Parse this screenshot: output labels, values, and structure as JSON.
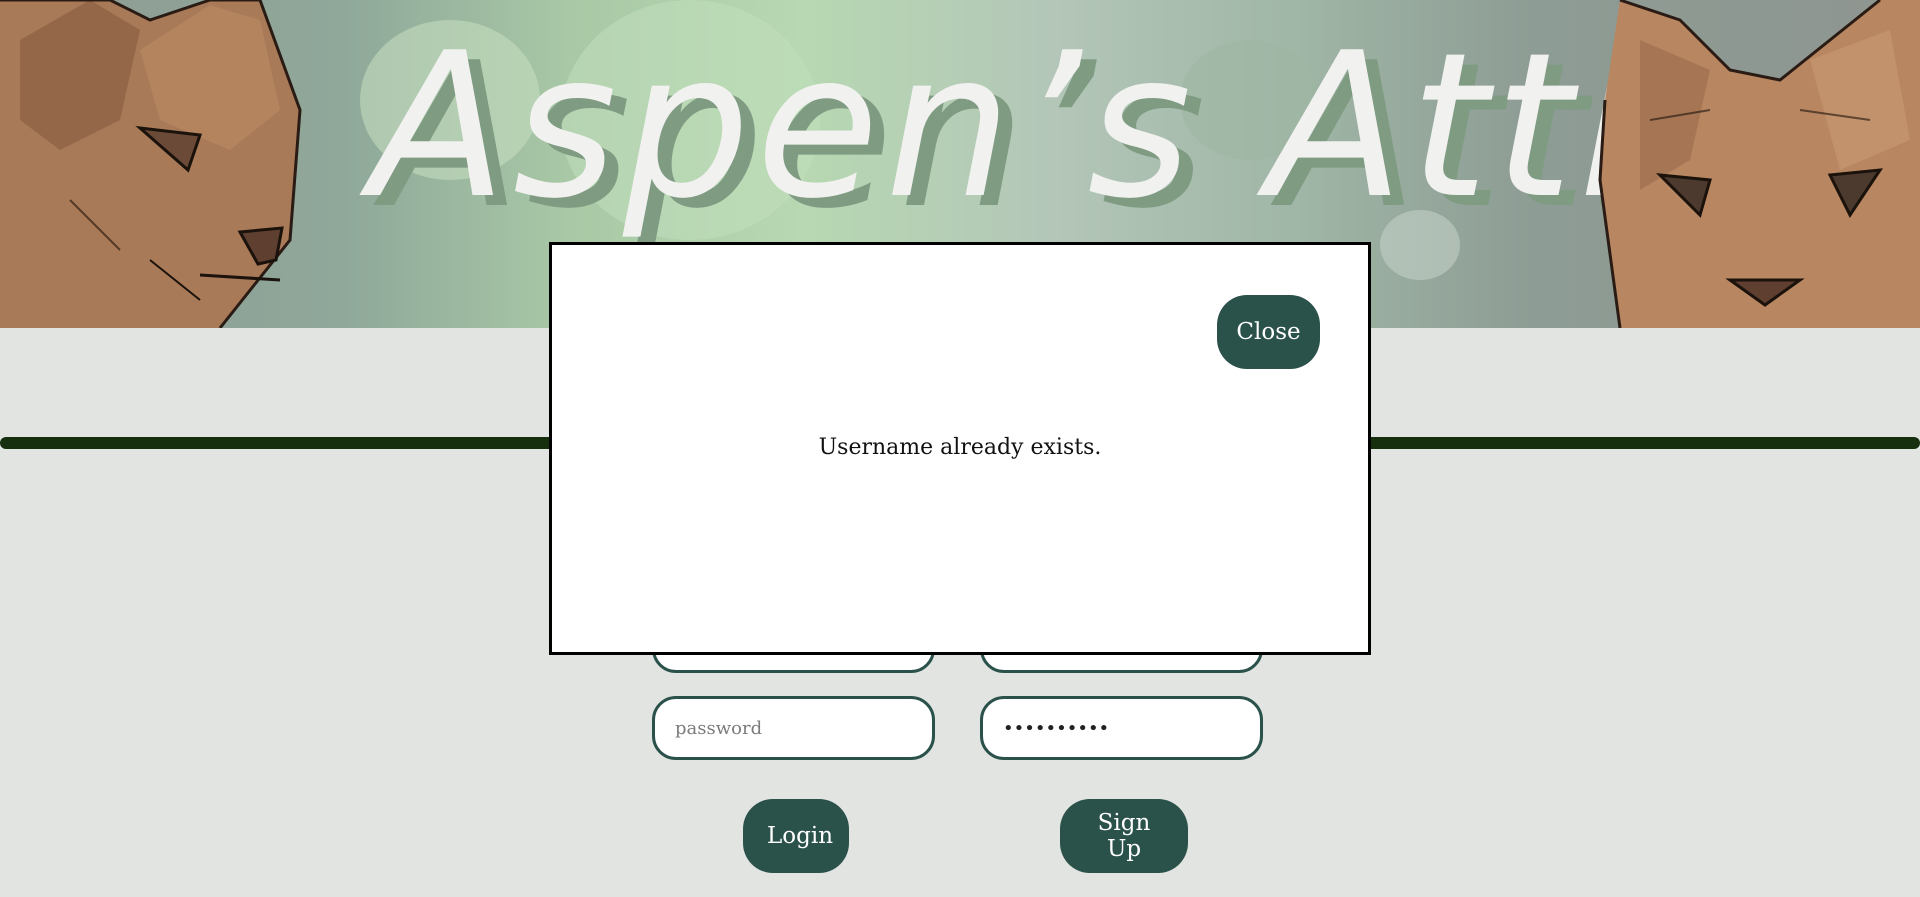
{
  "banner": {
    "title": "Aspen’s Attic"
  },
  "login_form": {
    "password_placeholder": "password",
    "login_label": "Login"
  },
  "signup_form": {
    "password_value": "••••••••••",
    "signup_label": "Sign Up"
  },
  "modal": {
    "close_label": "Close",
    "message": "Username already exists."
  },
  "colors": {
    "accent": "#2b514b",
    "divider": "#16300f",
    "background": "#e1e4e1"
  }
}
